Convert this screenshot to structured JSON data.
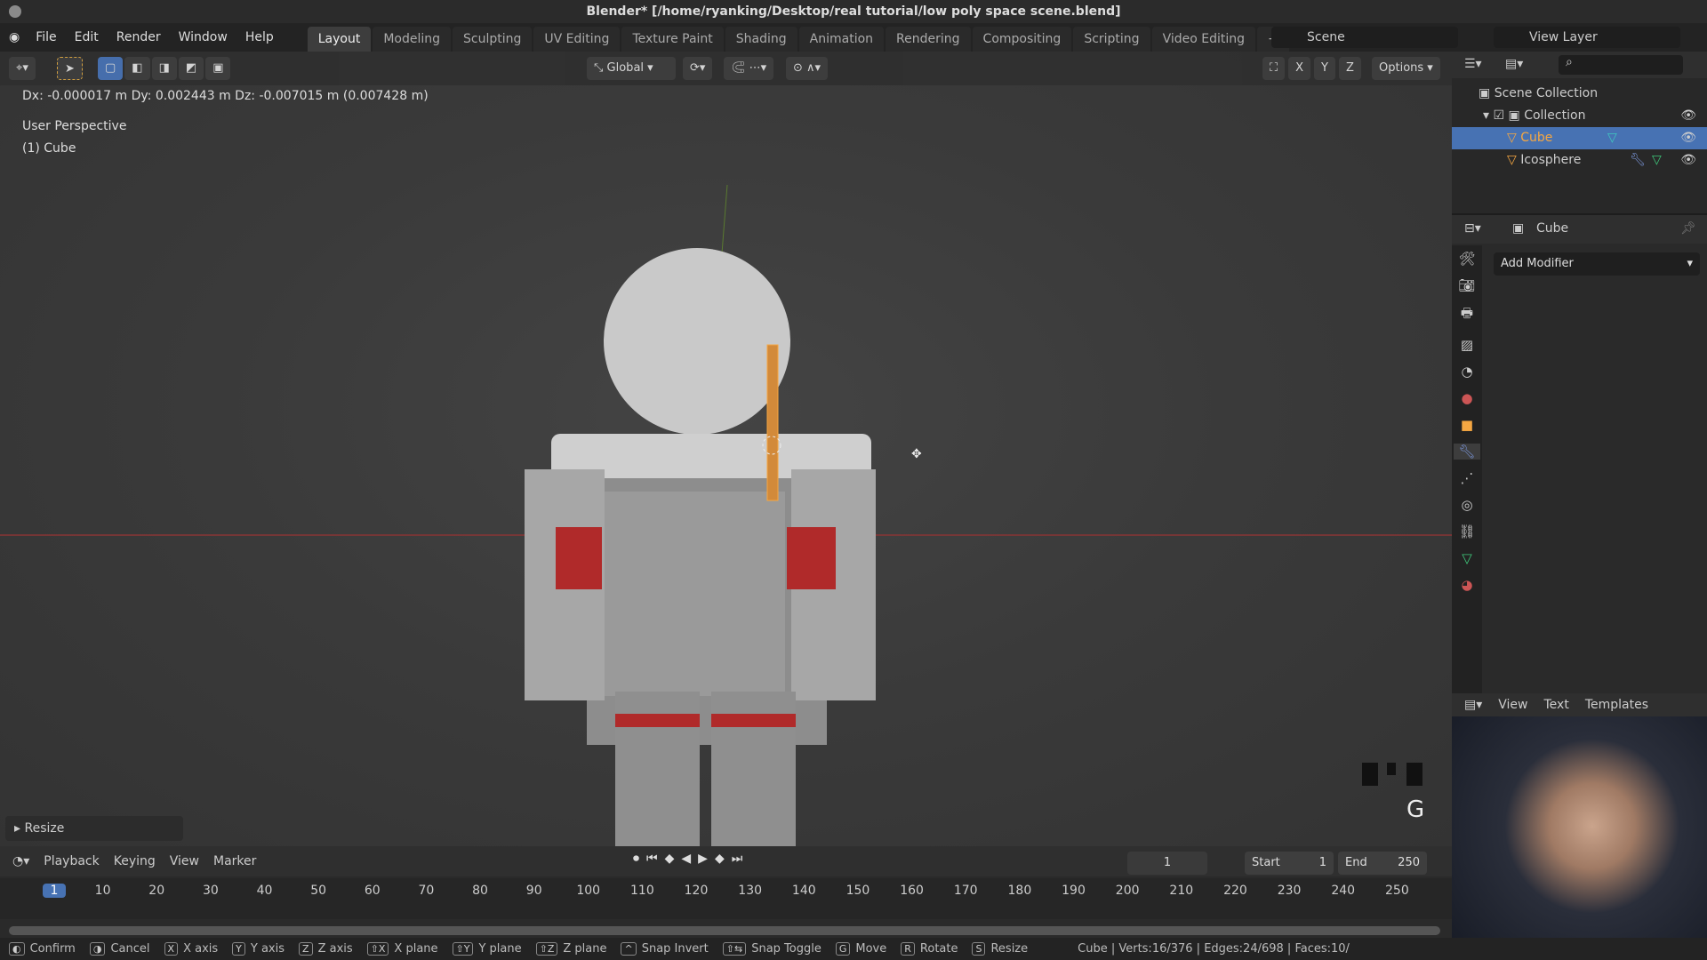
{
  "window": {
    "title": "Blender* [/home/ryanking/Desktop/real tutorial/low poly space scene.blend]"
  },
  "menu": [
    "File",
    "Edit",
    "Render",
    "Window",
    "Help"
  ],
  "workspaces": [
    "Layout",
    "Modeling",
    "Sculpting",
    "UV Editing",
    "Texture Paint",
    "Shading",
    "Animation",
    "Rendering",
    "Compositing",
    "Scripting",
    "Video Editing"
  ],
  "active_workspace": "Layout",
  "scene": {
    "label": "Scene",
    "view_layer": "View Layer"
  },
  "viewport": {
    "orientation": "Global",
    "options": "Options",
    "axes": [
      "X",
      "Y",
      "Z"
    ],
    "transform_readout": "Dx: -0.000017 m   Dy: 0.002443 m   Dz: -0.007015 m (0.007428 m)",
    "view_name": "User Perspective",
    "object_info": "(1) Cube",
    "last_op": "Resize",
    "key_hint": "G"
  },
  "outliner": {
    "root": "Scene Collection",
    "collection": "Collection",
    "items": [
      {
        "name": "Cube",
        "selected": true
      },
      {
        "name": "Icosphere",
        "selected": false
      }
    ]
  },
  "properties": {
    "object": "Cube",
    "add_modifier": "Add Modifier"
  },
  "text_editor": {
    "menu": [
      "View",
      "Text",
      "Templates"
    ]
  },
  "timeline": {
    "menus": [
      "Playback",
      "Keying",
      "View",
      "Marker"
    ],
    "current_frame": "1",
    "start_label": "Start",
    "start": "1",
    "end_label": "End",
    "end": "250",
    "ticks": [
      "1",
      "10",
      "20",
      "30",
      "40",
      "50",
      "60",
      "70",
      "80",
      "90",
      "100",
      "110",
      "120",
      "130",
      "140",
      "150",
      "160",
      "170",
      "180",
      "190",
      "200",
      "210",
      "220",
      "230",
      "240",
      "250"
    ]
  },
  "status": {
    "hints": [
      {
        "key": "◐",
        "label": "Confirm"
      },
      {
        "key": "◑",
        "label": "Cancel"
      },
      {
        "key": "X",
        "label": "X axis"
      },
      {
        "key": "Y",
        "label": "Y axis"
      },
      {
        "key": "Z",
        "label": "Z axis"
      },
      {
        "key": "⇧X",
        "label": "X plane"
      },
      {
        "key": "⇧Y",
        "label": "Y plane"
      },
      {
        "key": "⇧Z",
        "label": "Z plane"
      },
      {
        "key": "^",
        "label": "Snap Invert"
      },
      {
        "key": "⇧⇆",
        "label": "Snap Toggle"
      },
      {
        "key": "G",
        "label": "Move"
      },
      {
        "key": "R",
        "label": "Rotate"
      },
      {
        "key": "S",
        "label": "Resize"
      }
    ],
    "stats": "Cube | Verts:16/376 | Edges:24/698 | Faces:10/"
  },
  "colors": {
    "selection": "#4772b3",
    "active_object": "#f5a742",
    "x_axis": "#c24040",
    "accent": "#5680c2"
  }
}
